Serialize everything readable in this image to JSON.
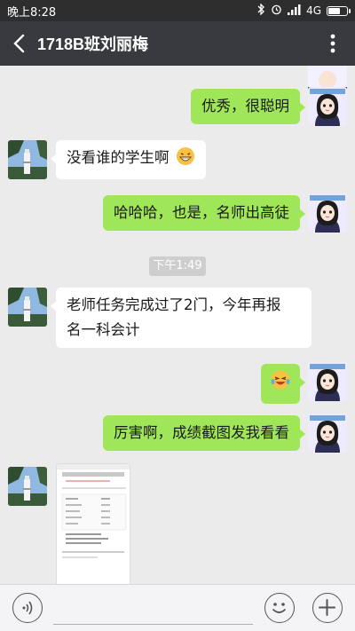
{
  "status": {
    "time": "晚上8:28",
    "network": "4G",
    "battery_level": 0.7
  },
  "header": {
    "title": "1718B班刘丽梅"
  },
  "messages": [
    {
      "side": "right",
      "text": "优秀，很聪明"
    },
    {
      "side": "left",
      "text": "没看谁的学生啊",
      "emoji": "grinning-face"
    },
    {
      "side": "right",
      "text": "哈哈哈，也是，名师出高徒"
    },
    {
      "side": "center",
      "text": "下午1:49"
    },
    {
      "side": "left",
      "text_line1": "老师任务完成过了2门，今年再报",
      "text_line2": "名一科会计"
    },
    {
      "side": "right",
      "emoji": "laughing-tears-face"
    },
    {
      "side": "right",
      "text": "厉害啊，成绩截图发我看看"
    },
    {
      "side": "left",
      "type": "image",
      "description": "score-screenshot-thumbnail"
    }
  ],
  "colors": {
    "outgoing_bubble": "#9fe658",
    "incoming_bubble": "#ffffff",
    "header_bg": "#393a3f",
    "chat_bg": "#ebebeb"
  }
}
